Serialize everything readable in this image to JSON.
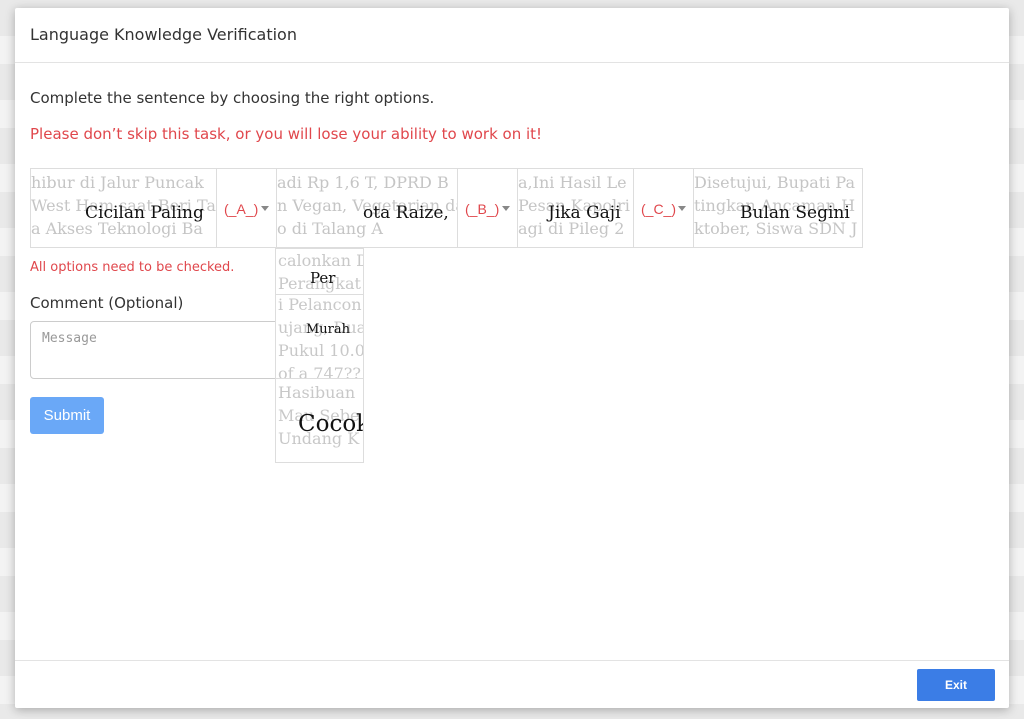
{
  "modal": {
    "title": "Language Knowledge Verification",
    "instruction": "Complete the sentence by choosing the right options.",
    "warning": "Please don’t skip this task, or you will lose your ability to work on it!"
  },
  "sentence": {
    "fragments": [
      {
        "bg_lines": [
          "hibur di Jalur Puncak",
          "West Ham saat Beri Ta",
          "a Akses Teknologi Ba"
        ],
        "text": "Cicilan Paling"
      },
      {
        "bg_lines": [
          "adi Rp 1,6 T, DPRD B",
          "n Vegan, Vegetarian da",
          "o di Talang A"
        ],
        "text": "ota Raize,"
      },
      {
        "bg_lines": [
          "a,Ini Hasil Le",
          "Pesan Kapolri",
          "agi di Pileg 2"
        ],
        "text": "Jika Gaji"
      },
      {
        "bg_lines": [
          "Disetujui, Bupati Pa",
          "tingkan Ancaman H",
          "ktober, Siswa SDN J"
        ],
        "text": "Bulan Segini"
      }
    ],
    "selects": [
      {
        "label": "(_A_)"
      },
      {
        "label": "(_B_)"
      },
      {
        "label": "(_C_)"
      }
    ]
  },
  "dropdown": {
    "options": [
      {
        "bg_lines": [
          "calonkan D",
          "Perangkat"
        ],
        "text": "Per"
      },
      {
        "bg_lines": [
          "i Pelancon",
          "ujang, Dua",
          "Pukul 10.0",
          "of a 747??"
        ],
        "text": "Murah"
      },
      {
        "bg_lines": [
          "Hasibuan",
          "Mau Sebe",
          "Undang K"
        ],
        "text": "Cocok"
      }
    ]
  },
  "form": {
    "error": "All options need to be checked.",
    "comment_label": "Comment (Optional)",
    "comment_placeholder": "Message",
    "submit_label": "Submit"
  },
  "footer": {
    "exit_label": "Exit"
  },
  "colors": {
    "error_red": "#e0474c",
    "submit_blue": "#6aa8f7",
    "exit_blue": "#3b7de6"
  }
}
